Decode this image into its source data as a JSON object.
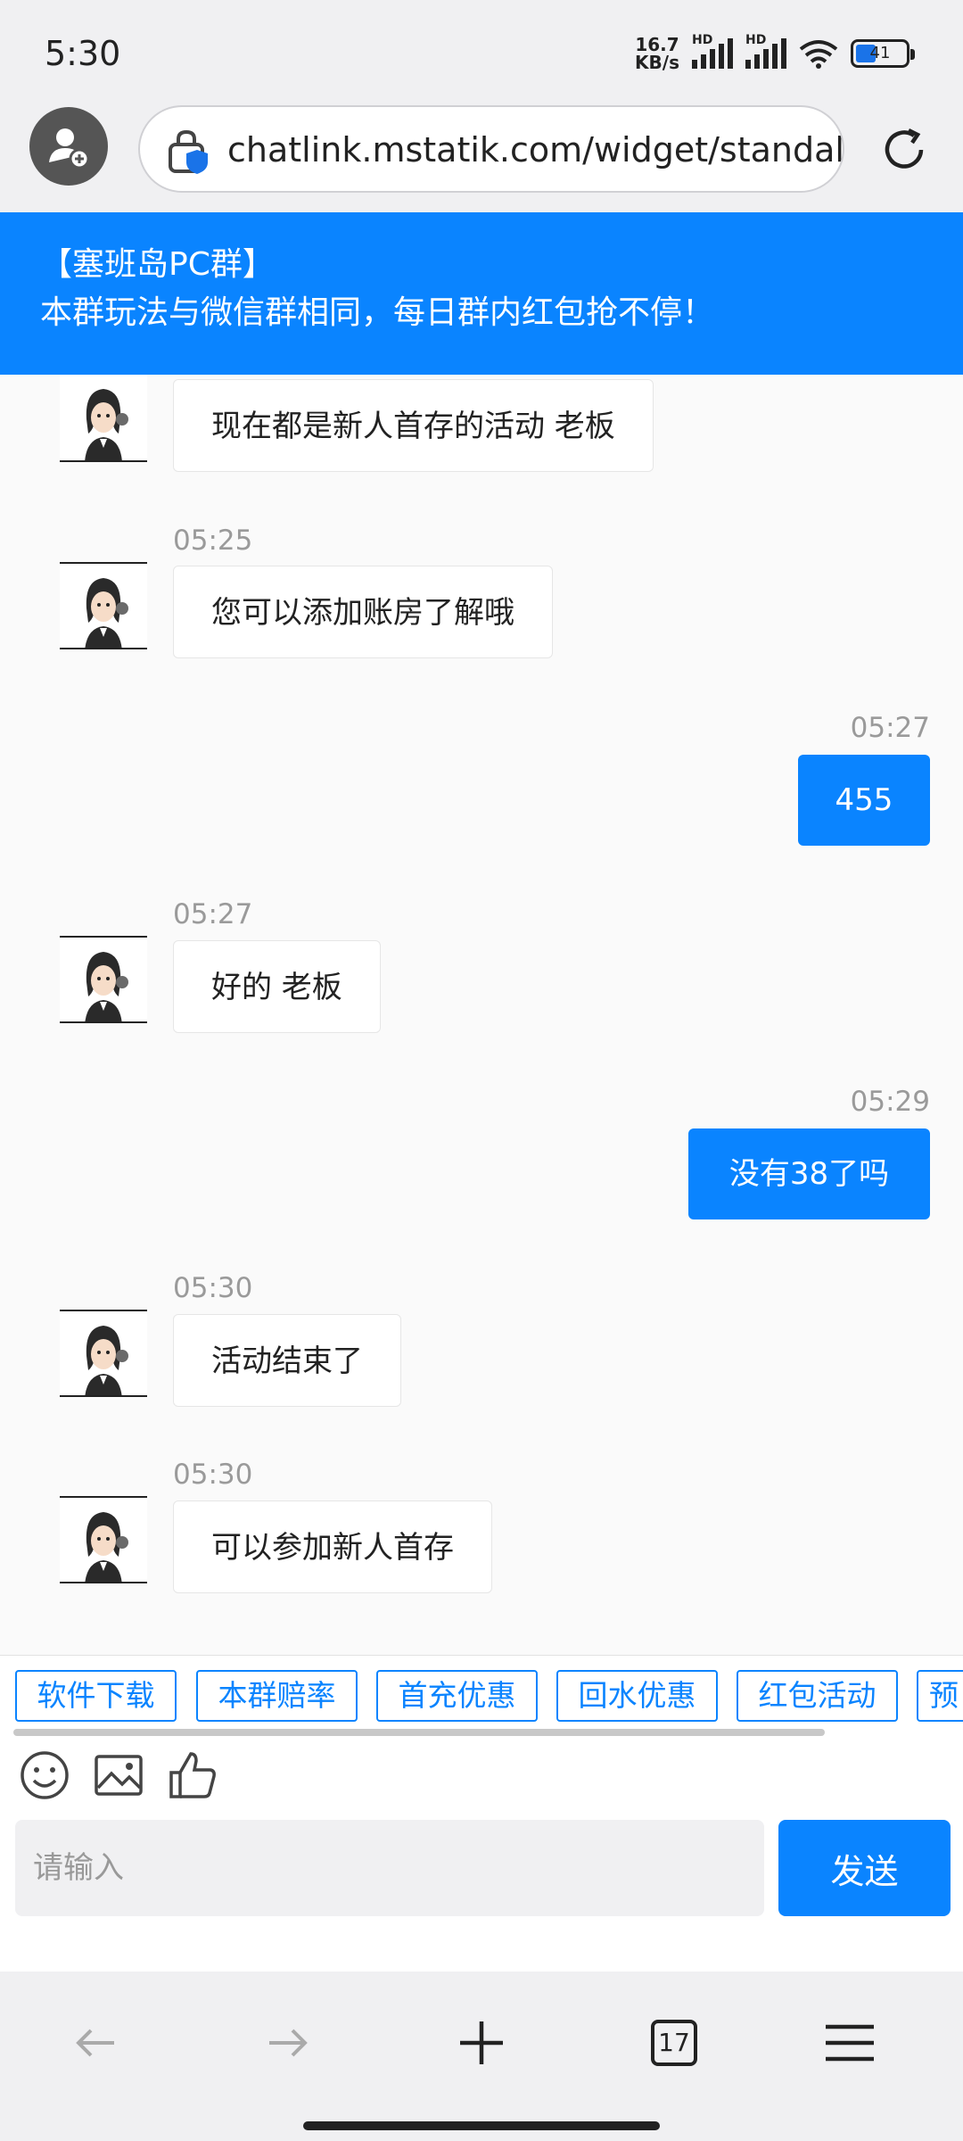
{
  "status_bar": {
    "time": "5:30",
    "net_speed_value": "16.7",
    "net_speed_unit": "KB/s",
    "sim1_label": "HD",
    "sim2_label": "HD",
    "battery_level": "41"
  },
  "browser": {
    "url": "chatlink.mstatik.com/widget/standalone"
  },
  "chat": {
    "banner_line1": "【塞班岛PC群】",
    "banner_line2": "本群玩法与微信群相同，每日群内红包抢不停！",
    "messages": [
      {
        "side": "in",
        "time": "",
        "text": "现在都是新人首存的活动 老板"
      },
      {
        "side": "in",
        "time": "05:25",
        "text": "您可以添加账房了解哦"
      },
      {
        "side": "out",
        "time": "05:27",
        "text": "455"
      },
      {
        "side": "in",
        "time": "05:27",
        "text": "好的 老板"
      },
      {
        "side": "out",
        "time": "05:29",
        "text": "没有38了吗"
      },
      {
        "side": "in",
        "time": "05:30",
        "text": "活动结束了"
      },
      {
        "side": "in",
        "time": "05:30",
        "text": "可以参加新人首存"
      }
    ],
    "quick_replies": [
      "软件下载",
      "本群赔率",
      "首充优惠",
      "回水优惠",
      "红包活动",
      "预"
    ],
    "input_placeholder": "请输入",
    "send_label": "发送"
  },
  "bottom_nav": {
    "tabs_count": "17"
  },
  "colors": {
    "accent": "#0a84ff"
  }
}
